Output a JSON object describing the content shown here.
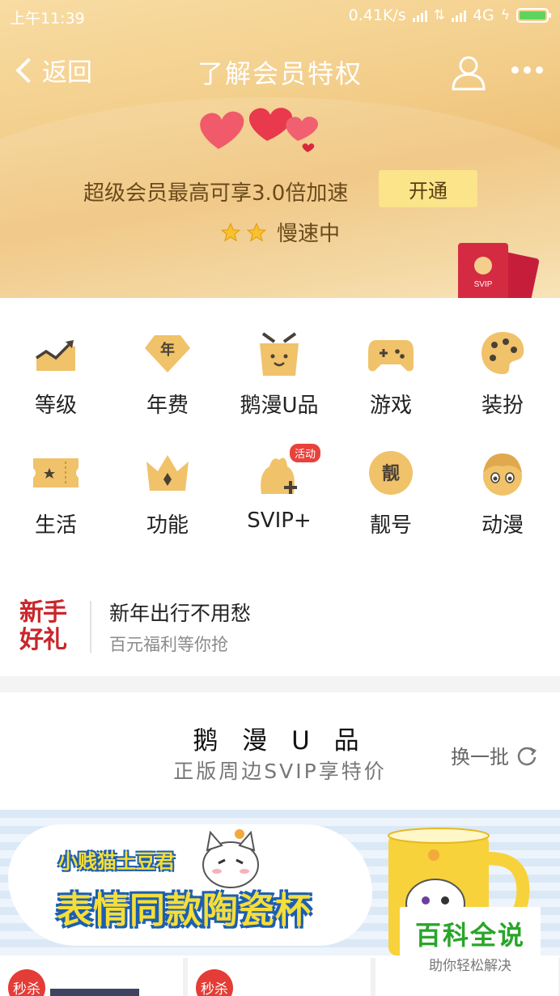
{
  "status_bar": {
    "time": "上午11:39",
    "network_speed": "0.41K/s",
    "network_type": "4G"
  },
  "nav": {
    "back_label": "返回",
    "title": "了解会员特权"
  },
  "hero": {
    "promo_text": "超级会员最高可享3.0倍加速",
    "open_button": "开通",
    "speed_status": "慢速中",
    "star_count": 2,
    "svip_card_label": "SVIP"
  },
  "privileges": [
    {
      "label": "等级",
      "icon": "trend-chart-icon"
    },
    {
      "label": "年费",
      "icon": "annual-fee-icon",
      "icon_text": "年"
    },
    {
      "label": "鹅漫U品",
      "icon": "u-goods-box-icon"
    },
    {
      "label": "游戏",
      "icon": "gamepad-icon"
    },
    {
      "label": "装扮",
      "icon": "palette-icon"
    },
    {
      "label": "生活",
      "icon": "ticket-icon"
    },
    {
      "label": "功能",
      "icon": "crown-icon"
    },
    {
      "label": "SVIP+",
      "icon": "svip-plus-icon",
      "badge": "活动"
    },
    {
      "label": "靓号",
      "icon": "pretty-number-icon",
      "icon_text": "靓"
    },
    {
      "label": "动漫",
      "icon": "anime-face-icon"
    }
  ],
  "gift": {
    "logo_line1": "新手",
    "logo_line2": "好礼",
    "title": "新年出行不用愁",
    "subtitle": "百元福利等你抢"
  },
  "goods": {
    "title": "鹅 漫 U 品",
    "subtitle": "正版周边SVIP享特价",
    "refresh_label": "换一批",
    "banner_line1": "小贱猫土豆君",
    "banner_line2": "表情同款陶瓷杯",
    "sale_badge": "秒杀"
  },
  "watermark": {
    "title": "百科全说",
    "subtitle": "助你轻松解决"
  },
  "colors": {
    "hero_gold": "#f3cf8c",
    "button_yellow": "#fbe48a",
    "icon_gold": "#f0c26a",
    "badge_red": "#e8423c",
    "watermark_green": "#2aa52a"
  }
}
